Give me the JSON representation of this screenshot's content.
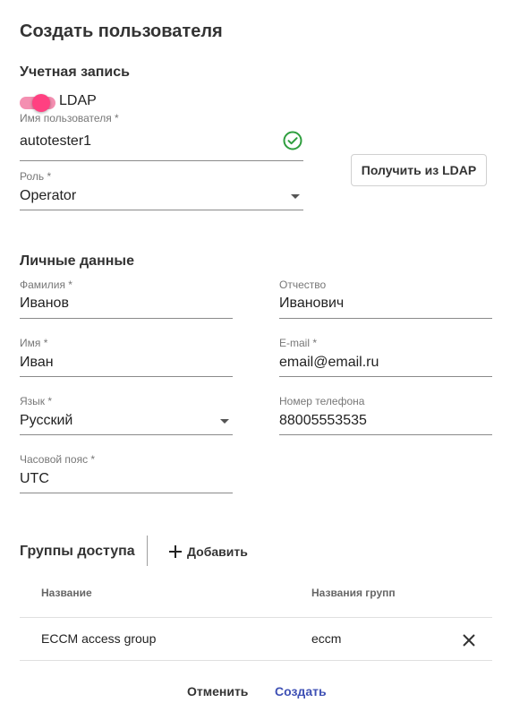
{
  "dialog": {
    "title": "Создать пользователя",
    "cancel_label": "Отменить",
    "create_label": "Создать"
  },
  "account": {
    "section_title": "Учетная запись",
    "ldap_label": "LDAP",
    "ldap_enabled": true,
    "username": {
      "label": "Имя пользователя *",
      "value": "autotester1"
    },
    "role": {
      "label": "Роль *",
      "value": "Operator"
    },
    "ldap_button_label": "Получить из LDAP"
  },
  "personal": {
    "section_title": "Личные данные",
    "last_name": {
      "label": "Фамилия *",
      "value": "Иванов"
    },
    "patronymic": {
      "label": "Отчество",
      "value": "Иванович"
    },
    "first_name": {
      "label": "Имя *",
      "value": "Иван"
    },
    "email": {
      "label": "E-mail *",
      "value": "email@email.ru"
    },
    "language": {
      "label": "Язык *",
      "value": "Русский"
    },
    "phone": {
      "label": "Номер телефона",
      "value": "88005553535"
    },
    "timezone": {
      "label": "Часовой пояс *",
      "value": "UTC"
    }
  },
  "access_groups": {
    "section_title": "Группы доступа",
    "add_label": "Добавить",
    "columns": [
      "Название",
      "Названия групп"
    ],
    "rows": [
      {
        "name": "ECCM access group",
        "groups": "eccm"
      }
    ]
  },
  "colors": {
    "accent": "#ff4081",
    "success": "#2e9e3e",
    "primary_link": "#3f51b5"
  }
}
